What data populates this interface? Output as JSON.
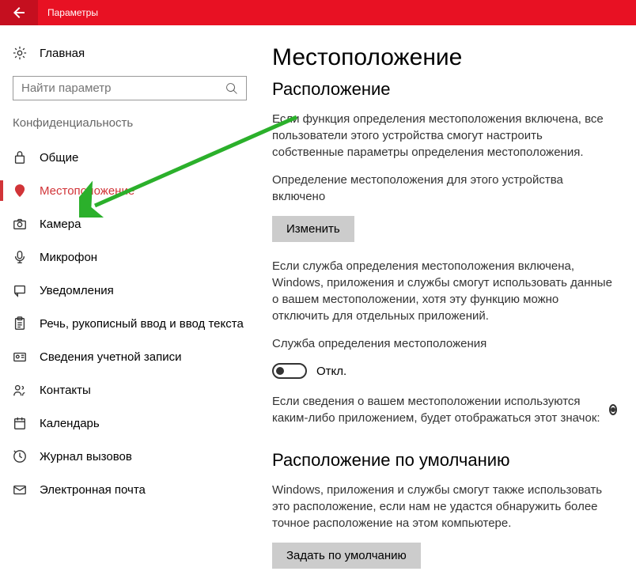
{
  "titlebar": {
    "title": "Параметры"
  },
  "sidebar": {
    "home": "Главная",
    "searchPlaceholder": "Найти параметр",
    "section": "Конфиденциальность",
    "items": [
      {
        "label": "Общие"
      },
      {
        "label": "Местоположение"
      },
      {
        "label": "Камера"
      },
      {
        "label": "Микрофон"
      },
      {
        "label": "Уведомления"
      },
      {
        "label": "Речь, рукописный ввод и ввод текста"
      },
      {
        "label": "Сведения учетной записи"
      },
      {
        "label": "Контакты"
      },
      {
        "label": "Календарь"
      },
      {
        "label": "Журнал вызовов"
      },
      {
        "label": "Электронная почта"
      }
    ]
  },
  "content": {
    "title": "Местоположение",
    "subtitle": "Расположение",
    "p1": "Если функция определения местоположения включена, все пользователи этого устройства смогут настроить собственные параметры определения местоположения.",
    "p2": "Определение местоположения для этого устройства включено",
    "changeBtn": "Изменить",
    "p3": "Если служба определения местоположения включена, Windows, приложения и службы смогут использовать данные о вашем местоположении, хотя эту функцию можно отключить для отдельных приложений.",
    "toggleTitle": "Служба определения местоположения",
    "toggleState": "Откл.",
    "p4": "Если сведения о вашем местоположении используются каким-либо приложением, будет отображаться этот значок:",
    "defaultTitle": "Расположение по умолчанию",
    "p5": "Windows, приложения и службы смогут также использовать это расположение, если нам не удастся обнаружить более точное расположение на этом компьютере.",
    "defaultBtn": "Задать по умолчанию"
  }
}
